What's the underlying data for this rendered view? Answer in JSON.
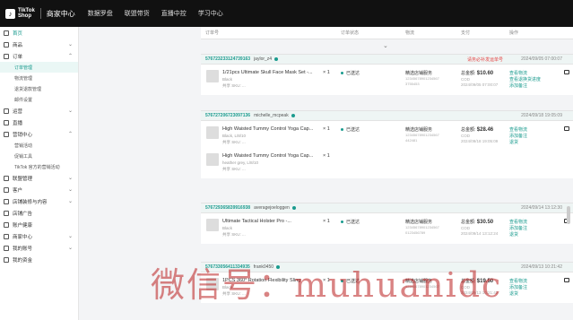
{
  "header": {
    "logo_text_line1": "TikTok",
    "logo_text_line2": "Shop",
    "brand": "商家中心",
    "nav": [
      "数据罗盘",
      "联盟带货",
      "直播中控",
      "学习中心"
    ]
  },
  "sidebar": {
    "items": [
      {
        "label": "首页",
        "type": "item",
        "active": true
      },
      {
        "label": "商品",
        "type": "item",
        "chev": "⌄"
      },
      {
        "label": "订单",
        "type": "item",
        "chev": "⌃"
      },
      {
        "label": "订单管理",
        "type": "sub",
        "active": true
      },
      {
        "label": "物流管理",
        "type": "sub"
      },
      {
        "label": "退货退款管理",
        "type": "sub"
      },
      {
        "label": "邮件设置",
        "type": "sub"
      },
      {
        "label": "运营",
        "type": "item",
        "chev": "⌄"
      },
      {
        "label": "直播",
        "type": "item"
      },
      {
        "label": "营销中心",
        "type": "item",
        "chev": "⌃"
      },
      {
        "label": "营销活动",
        "type": "sub"
      },
      {
        "label": "促销工具",
        "type": "sub"
      },
      {
        "label": "TikTok 官方的营销活动",
        "type": "sub"
      },
      {
        "label": "联盟管理",
        "type": "item",
        "chev": "⌄"
      },
      {
        "label": "客户",
        "type": "item",
        "chev": "⌄"
      },
      {
        "label": "店铺装修与内容",
        "type": "item",
        "chev": "⌄"
      },
      {
        "label": "店铺广告",
        "type": "item"
      },
      {
        "label": "账户健康",
        "type": "item"
      },
      {
        "label": "商家中心",
        "type": "item",
        "chev": "⌄"
      },
      {
        "label": "我的账号",
        "type": "item",
        "chev": "⌄"
      },
      {
        "label": "我的资金",
        "type": "item"
      }
    ]
  },
  "table": {
    "headers": [
      "订单号",
      "订单状态",
      "物流",
      "支付",
      "操作"
    ]
  },
  "orders": [
    {
      "id": "576723233124739163",
      "user": "jaylor_z4",
      "warning": "请务必补发运单号",
      "time": "2024/09/05 07:00:07",
      "products": [
        {
          "title": "1/21pcs Ultimate Skull Face Mask Set -...",
          "sub": "Black",
          "sub2": "共享 SKU: ...",
          "qty": "× 1"
        }
      ],
      "status": "已送达",
      "shipping": "精选店铺服务",
      "shipping_no": "12345678901234567",
      "shipping_no2": "3755453",
      "amount_label": "总金额:",
      "amount": "$10.60",
      "payment": "COD",
      "pay_time": "2024/09/05 07:00:07",
      "actions": [
        "查看物流",
        "查看退换货进度",
        "添加备注"
      ]
    },
    {
      "id": "576727206723097136",
      "user": "michelle_mcpeak",
      "time": "2024/09/18 19:05:09",
      "products": [
        {
          "title": "High Waisted Tummy Control Yoga Cap...",
          "sub": "Black, L/8/10",
          "sub2": "共享 SKU: ...",
          "qty": "× 1"
        },
        {
          "title": "High Waisted Tummy Control Yoga Cap...",
          "sub": "heather grey, L/8/10",
          "sub2": "共享 SKU: ...",
          "qty": "× 1"
        }
      ],
      "status": "已送达",
      "shipping": "精选店铺服务",
      "shipping_no": "12345678901234567",
      "shipping_no2": "442481",
      "amount_label": "总金额:",
      "amount": "$28.46",
      "payment": "COD",
      "pay_time": "2024/09/18 19:05:09",
      "actions": [
        "查看物流",
        "添加备注",
        "退货"
      ]
    },
    {
      "id": "576729365839916938",
      "user": "averagejoeloggen",
      "time": "2024/09/14 13:12:30",
      "products": [
        {
          "title": "Ultimate Tactical Holster Pro -...",
          "sub": "Black",
          "sub2": "共享 SKU: ...",
          "qty": "× 1"
        }
      ],
      "status": "已送达",
      "shipping": "精选店铺服务",
      "shipping_no": "12345678901234567",
      "shipping_no2": "0123456789",
      "amount_label": "总金额:",
      "amount": "$30.50",
      "payment": "COD",
      "pay_time": "2024/09/14 13:12:24",
      "actions": [
        "查看物流",
        "添加备注",
        "退货"
      ]
    },
    {
      "id": "576733056411334935",
      "user": "frank0450",
      "time": "2024/09/13 10:21:42",
      "products": [
        {
          "title": "1PCS 360° Rotation Flexibility Sling",
          "sub": "Black",
          "sub2": "共享 SKU: ...",
          "qty": "× 1"
        }
      ],
      "status": "已送达",
      "shipping": "精选店铺服务",
      "shipping_no": "12345678901234567",
      "shipping_no2": "",
      "amount_label": "总金额:",
      "amount": "$19.50",
      "payment": "COD",
      "pay_time": "2024/09/13 10:21:42",
      "actions": [
        "查看物流",
        "添加备注",
        "退货"
      ]
    }
  ],
  "watermark": "微信号：muhuanidc"
}
